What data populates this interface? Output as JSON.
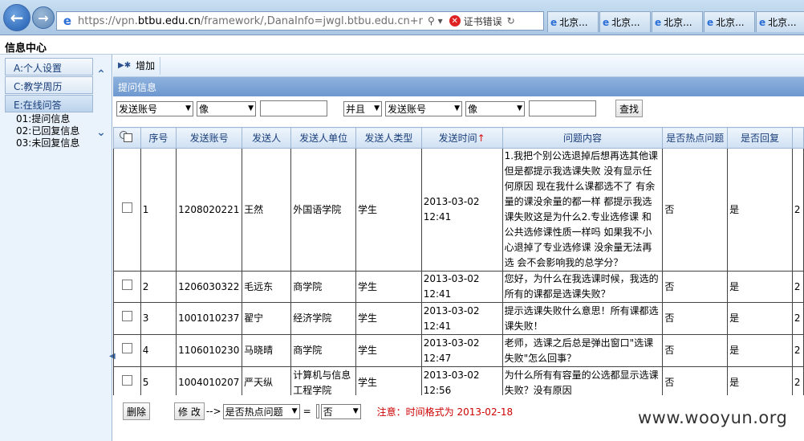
{
  "browser": {
    "url_prefix": "https://vpn.",
    "url_domain": "btbu.edu.cn",
    "url_suffix": "/framework/,DanaInfo=jwgl.btbu.edu.cn+main.jsp",
    "search_icon": "search-icon",
    "cert_error": "证书错误",
    "tabs": [
      "北京...",
      "北京...",
      "北京...",
      "北京...",
      "北京..."
    ]
  },
  "app": {
    "title": "信息中心"
  },
  "sidebar": {
    "items": [
      {
        "label": "A:个人设置"
      },
      {
        "label": "C:教学周历"
      },
      {
        "label": "E:在线问答"
      }
    ],
    "subitems": [
      "01:提问信息",
      "02:已回复信息",
      "03:未回复信息"
    ]
  },
  "toolbar": {
    "add_label": "增加"
  },
  "section": {
    "title": "提问信息"
  },
  "search": {
    "field1": "发送账号",
    "op1": "像",
    "value1": "",
    "join": "并且",
    "field2": "发送账号",
    "op2": "像",
    "value2": "",
    "button": "查找"
  },
  "table": {
    "headers": [
      "序号",
      "发送账号",
      "发送人",
      "发送人单位",
      "发送人类型",
      "发送时间",
      "问题内容",
      "是否热点问题",
      "是否回复"
    ],
    "sort_marker": "↑",
    "rows": [
      {
        "no": "1",
        "account": "1208020221",
        "name": "王然",
        "unit": "外国语学院",
        "type": "学生",
        "time": "2013-03-02 12:41",
        "content": "1.我把个别公选退掉后想再选其他课但是都提示我选课失败 没有显示任何原因 现在我什么课都选不了 有余量的课没余量的都一样 都提示我选课失败这是为什么2.专业选修课 和公共选修课性质一样吗 如果我不小心退掉了专业选修课 没余量无法再选 会不会影响我的总学分？",
        "hot": "否",
        "replied": "是",
        "extra": "2"
      },
      {
        "no": "2",
        "account": "1206030322",
        "name": "毛远东",
        "unit": "商学院",
        "type": "学生",
        "time": "2013-03-02 12:41",
        "content": "您好，为什么在我选课时候，我选的所有的课都是选课失败？",
        "hot": "否",
        "replied": "是",
        "extra": "2"
      },
      {
        "no": "3",
        "account": "1001010237",
        "name": "翟宁",
        "unit": "经济学院",
        "type": "学生",
        "time": "2013-03-02 12:41",
        "content": "提示选课失败什么意思！所有课都选课失败！",
        "hot": "否",
        "replied": "是",
        "extra": "2"
      },
      {
        "no": "4",
        "account": "1106010230",
        "name": "马晓晴",
        "unit": "商学院",
        "type": "学生",
        "time": "2013-03-02 12:47",
        "content": "老师，选课之后总是弹出窗口\"选课失败\"怎么回事？",
        "hot": "否",
        "replied": "是",
        "extra": "2"
      },
      {
        "no": "5",
        "account": "1004010207",
        "name": "严天纵",
        "unit": "计算机与信息工程学院",
        "type": "学生",
        "time": "2013-03-02 12:56",
        "content": "为什么所有有容量的公选都显示选课失败？没有原因",
        "hot": "否",
        "replied": "是",
        "extra": "2"
      }
    ]
  },
  "footer": {
    "delete_label": "删除",
    "modify_label": "修 改",
    "arrow": "-->",
    "field": "是否热点问题",
    "equals": "=",
    "value": "否",
    "note": "注意：时间格式为 2013-02-18"
  },
  "watermark": "www.wooyun.org"
}
